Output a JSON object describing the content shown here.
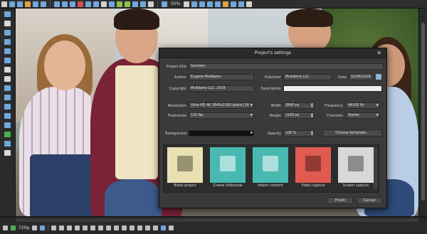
{
  "toolbar": {
    "zoom": "50%"
  },
  "dialog": {
    "title": "Project's settings",
    "close_glyph": "✕",
    "project_title_label": "Project title",
    "project_title_value": "Summer",
    "author_label": "Author",
    "author_value": "Eugene McAdams",
    "publisher_label": "Publisher",
    "publisher_value": "McAdams LLC",
    "date_label": "Date",
    "date_value": "10/06/2018",
    "copyright_label": "Copyright",
    "copyright_value": "McAdams LLC, 2019",
    "description_label": "Description",
    "description_value": "",
    "resolution_label": "Resolution",
    "resolution_value": "Ultra HD 4K 3840x2160 pixels (16",
    "width_label": "Width",
    "width_value": "3840 px",
    "frequency_label": "Frequency",
    "frequency_value": "44100 Hz",
    "framerate_label": "Framerate",
    "framerate_value": "120 fps",
    "height_label": "Height",
    "height_value": "2160 px",
    "channels_label": "Channels",
    "channels_value": "Stereo",
    "background_label": "Background",
    "background_value": "",
    "opacity_label": "Opacity",
    "opacity_value": "100 %",
    "choose_template_label": "Choose template...",
    "tiles": [
      {
        "label": "Blank project",
        "color": "#e8e0b0",
        "icon": "film-camera-icon"
      },
      {
        "label": "Create slideshow",
        "color": "#48b8b0",
        "icon": "slideshow-icon"
      },
      {
        "label": "Import content",
        "color": "#48b8b0",
        "icon": "import-icon"
      },
      {
        "label": "Video capture",
        "color": "#e05a50",
        "icon": "video-camera-icon"
      },
      {
        "label": "Screen capture",
        "color": "#d8d8d8",
        "icon": "monitor-icon"
      }
    ],
    "finish_label": "Finish",
    "cancel_label": "Cancel"
  },
  "timeline": {
    "resolution": "720p"
  }
}
